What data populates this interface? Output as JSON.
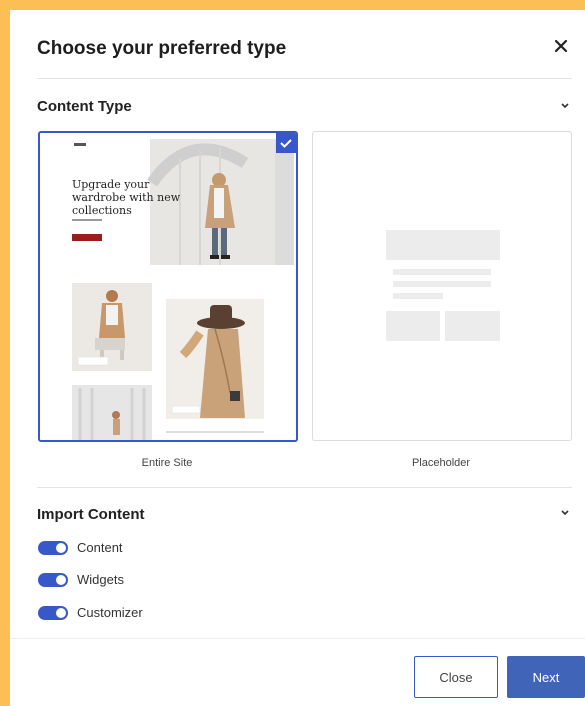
{
  "dialog": {
    "title": "Choose your preferred type",
    "close_icon": "close-icon"
  },
  "content_type": {
    "title": "Content Type",
    "options": [
      {
        "label": "Entire Site",
        "selected": true
      },
      {
        "label": "Placeholder",
        "selected": false
      }
    ],
    "preview": {
      "headline": "Upgrade your wardrobe with new collections"
    }
  },
  "import_content": {
    "title": "Import Content",
    "toggles": [
      {
        "label": "Content",
        "on": true
      },
      {
        "label": "Widgets",
        "on": true
      },
      {
        "label": "Customizer",
        "on": true
      }
    ]
  },
  "footer": {
    "close_label": "Close",
    "next_label": "Next"
  },
  "colors": {
    "accent": "#3858c9",
    "next_button": "#4065b8",
    "frame": "#fbbf55"
  }
}
